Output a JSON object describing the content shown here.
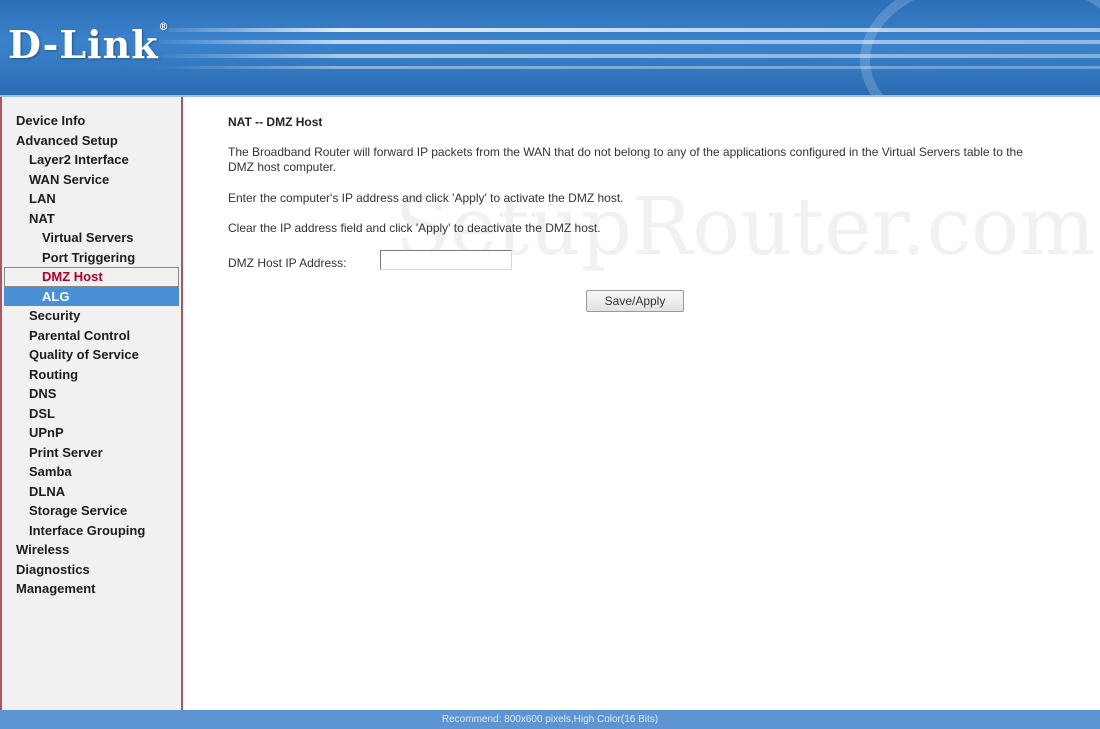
{
  "header": {
    "logo_text": "D-Link",
    "logo_mark": "®"
  },
  "sidebar": {
    "items": [
      {
        "label": "Device Info",
        "level": 0
      },
      {
        "label": "Advanced Setup",
        "level": 0
      },
      {
        "label": "Layer2 Interface",
        "level": 1
      },
      {
        "label": "WAN Service",
        "level": 1
      },
      {
        "label": "LAN",
        "level": 1
      },
      {
        "label": "NAT",
        "level": 1
      },
      {
        "label": "Virtual Servers",
        "level": 2
      },
      {
        "label": "Port Triggering",
        "level": 2
      },
      {
        "label": "DMZ Host",
        "level": 2,
        "state": "current"
      },
      {
        "label": "ALG",
        "level": 2,
        "state": "highlight"
      },
      {
        "label": "Security",
        "level": 1
      },
      {
        "label": "Parental Control",
        "level": 1
      },
      {
        "label": "Quality of Service",
        "level": 1
      },
      {
        "label": "Routing",
        "level": 1
      },
      {
        "label": "DNS",
        "level": 1
      },
      {
        "label": "DSL",
        "level": 1
      },
      {
        "label": "UPnP",
        "level": 1
      },
      {
        "label": "Print Server",
        "level": 1
      },
      {
        "label": "Samba",
        "level": 1
      },
      {
        "label": "DLNA",
        "level": 1
      },
      {
        "label": "Storage Service",
        "level": 1
      },
      {
        "label": "Interface Grouping",
        "level": 1
      },
      {
        "label": "Wireless",
        "level": 0
      },
      {
        "label": "Diagnostics",
        "level": 0
      },
      {
        "label": "Management",
        "level": 0
      }
    ]
  },
  "main": {
    "title": "NAT -- DMZ Host",
    "description": "The Broadband Router will forward IP packets from the WAN that do not belong to any of the applications configured in the Virtual Servers table to the DMZ host computer.",
    "instruction_activate": "Enter the computer's IP address and click 'Apply' to activate the DMZ host.",
    "instruction_deactivate": "Clear the IP address field and click 'Apply' to deactivate the DMZ host.",
    "ip_label": "DMZ Host IP Address:",
    "ip_value": "",
    "apply_label": "Save/Apply"
  },
  "watermark": "SetupRouter.com",
  "footer": {
    "text": "Recommend: 800x600 pixels,High Color(16 Bits)"
  },
  "colors": {
    "header_blue": "#3a83cc",
    "sidebar_border": "#b0555f",
    "current_item": "#b0002a",
    "highlight_bg": "#4a90d6",
    "footer_bg": "#5c95d2"
  }
}
